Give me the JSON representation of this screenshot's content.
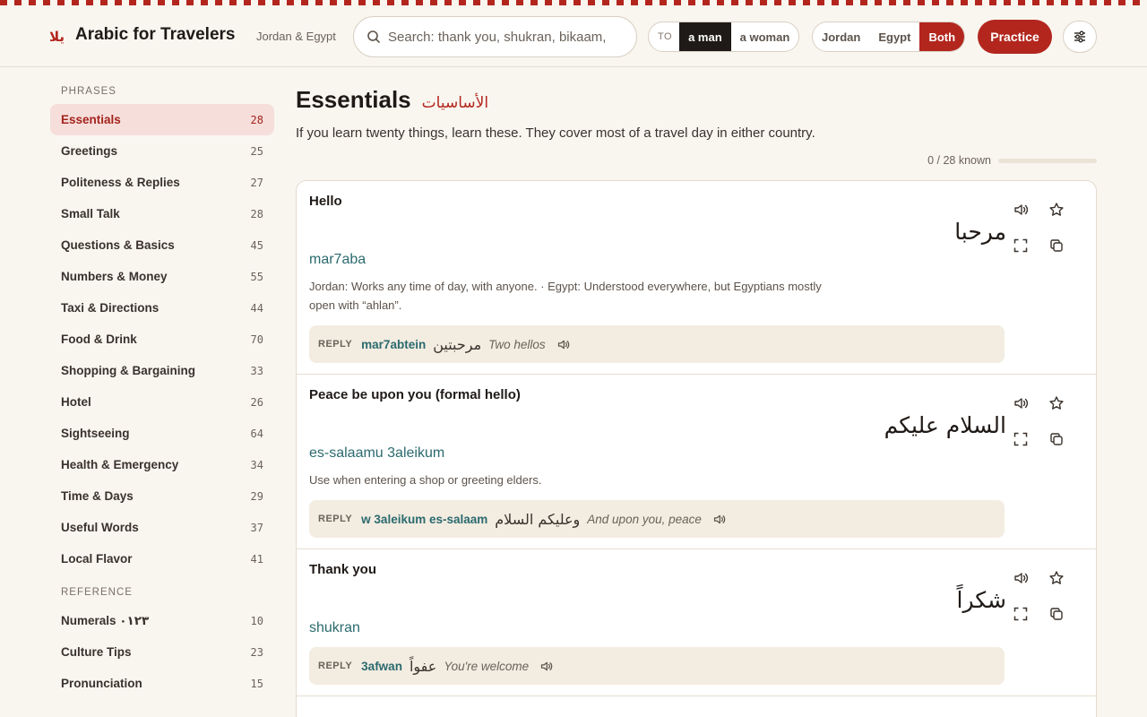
{
  "app": {
    "logo_ar": "يلا",
    "title": "Arabic for Travelers",
    "subtitle": "Jordan & Egypt"
  },
  "search": {
    "placeholder": "Search: thank you, shukran, bikaam,"
  },
  "addressee": {
    "label": "TO",
    "options": [
      "a man",
      "a woman"
    ],
    "selected": "a man"
  },
  "dialect": {
    "options": [
      "Jordan",
      "Egypt",
      "Both"
    ],
    "selected": "Both"
  },
  "toolbar": {
    "practice_label": "Practice",
    "settings_icon": "sliders-icon"
  },
  "sidebar": {
    "phrases_heading": "PHRASES",
    "phrases": [
      {
        "label": "Essentials",
        "count": "28",
        "active": true
      },
      {
        "label": "Greetings",
        "count": "25"
      },
      {
        "label": "Politeness & Replies",
        "count": "27"
      },
      {
        "label": "Small Talk",
        "count": "28"
      },
      {
        "label": "Questions & Basics",
        "count": "45"
      },
      {
        "label": "Numbers & Money",
        "count": "55"
      },
      {
        "label": "Taxi & Directions",
        "count": "44"
      },
      {
        "label": "Food & Drink",
        "count": "70"
      },
      {
        "label": "Shopping & Bargaining",
        "count": "33"
      },
      {
        "label": "Hotel",
        "count": "26"
      },
      {
        "label": "Sightseeing",
        "count": "64"
      },
      {
        "label": "Health & Emergency",
        "count": "34"
      },
      {
        "label": "Time & Days",
        "count": "29"
      },
      {
        "label": "Useful Words",
        "count": "37"
      },
      {
        "label": "Local Flavor",
        "count": "41"
      }
    ],
    "reference_heading": "REFERENCE",
    "reference": [
      {
        "label": "Numerals ٠١٢٣",
        "count": "10"
      },
      {
        "label": "Culture Tips",
        "count": "23"
      },
      {
        "label": "Pronunciation",
        "count": "15"
      }
    ]
  },
  "main": {
    "title": "Essentials",
    "title_ar": "الأساسيات",
    "description": "If you learn twenty things, learn these. They cover most of a travel day in either country.",
    "progress_text": "0 / 28 known",
    "progress_fraction": 0,
    "accent_color": "#b3261e",
    "translit_color": "#2b6a6e",
    "cards": [
      {
        "english": "Hello",
        "arabic": "مرحبا",
        "translit": "mar7aba",
        "note": "Jordan: Works any time of day, with anyone. · Egypt: Understood everywhere, but Egyptians mostly open with “ahlan”.",
        "reply": {
          "label": "REPLY",
          "translit": "mar7abtein",
          "arabic": "مرحبتين",
          "meaning": "Two hellos"
        }
      },
      {
        "english": "Peace be upon you (formal hello)",
        "arabic": "السلام عليكم",
        "translit": "es-salaamu 3aleikum",
        "note": "Use when entering a shop or greeting elders.",
        "reply": {
          "label": "REPLY",
          "translit": "w 3aleikum es-salaam",
          "arabic": "وعليكم السلام",
          "meaning": "And upon you, peace"
        }
      },
      {
        "english": "Thank you",
        "arabic": "شكراً",
        "translit": "shukran",
        "note": "",
        "reply": {
          "label": "REPLY",
          "translit": "3afwan",
          "arabic": "عفواً",
          "meaning": "You're welcome"
        }
      }
    ]
  }
}
